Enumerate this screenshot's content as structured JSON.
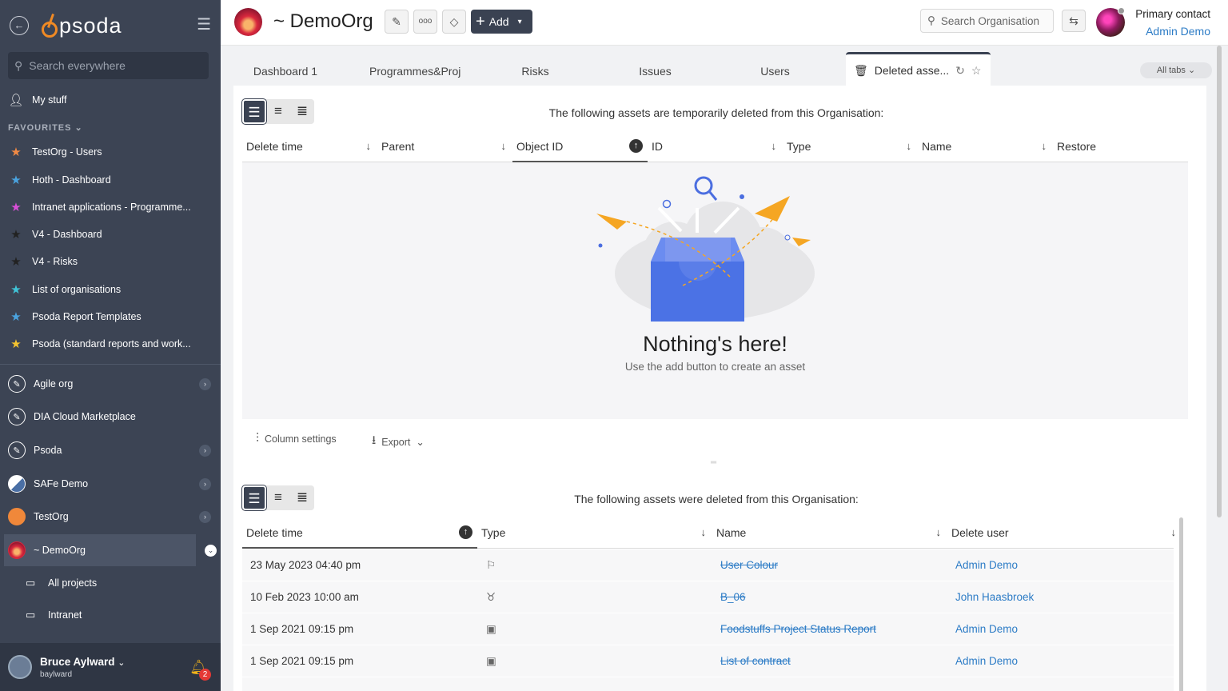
{
  "sidebar": {
    "logo": "psoda",
    "search_placeholder": "Search everywhere",
    "my_stuff": "My stuff",
    "favourites_heading": "FAVOURITES",
    "favourites": [
      {
        "label": "TestOrg - Users",
        "color": "#f08a45"
      },
      {
        "label": "Hoth - Dashboard",
        "color": "#4aa3df"
      },
      {
        "label": "Intranet applications - Programme...",
        "color": "#d94fd9"
      },
      {
        "label": "V4 - Dashboard",
        "color": "#2b2b2b"
      },
      {
        "label": "V4 - Risks",
        "color": "#2b2b2b"
      },
      {
        "label": "List of organisations",
        "color": "#40c4d8"
      },
      {
        "label": "Psoda Report Templates",
        "color": "#4aa3df"
      },
      {
        "label": "Psoda (standard reports and work...",
        "color": "#f4c430"
      }
    ],
    "orgs": [
      {
        "label": "Agile org"
      },
      {
        "label": "DIA Cloud Marketplace"
      },
      {
        "label": "Psoda"
      },
      {
        "label": "SAFe Demo"
      },
      {
        "label": "TestOrg"
      },
      {
        "label": "~ DemoOrg"
      }
    ],
    "sub_items": [
      "All projects",
      "Intranet"
    ],
    "user": {
      "name": "Bruce Aylward",
      "username": "baylward",
      "notifications": "2"
    }
  },
  "header": {
    "title": "~ DemoOrg",
    "add_label": "Add",
    "search_placeholder": "Search Organisation",
    "primary_contact_label": "Primary contact",
    "primary_contact_name": "Admin Demo"
  },
  "tabs": [
    "Dashboard 1",
    "Programmes&Proj",
    "Risks",
    "Issues",
    "Users",
    "Deleted asse..."
  ],
  "all_tabs_label": "All tabs",
  "temp_section": {
    "caption": "The following assets are temporarily deleted from this Organisation:",
    "columns": [
      "Delete time",
      "Parent",
      "Object ID",
      "ID",
      "Type",
      "Name",
      "Restore"
    ],
    "empty_title": "Nothing's here!",
    "empty_sub": "Use the add button to create an asset"
  },
  "toolbar": {
    "column_settings": "Column settings",
    "export": "Export"
  },
  "deleted_section": {
    "caption": "The following assets were deleted from this Organisation:",
    "columns": [
      "Delete time",
      "Type",
      "Name",
      "Delete user"
    ],
    "rows": [
      {
        "time": "23 May 2023 04:40 pm",
        "type_icon": "user-colour-icon",
        "name": "User Colour",
        "user": "Admin Demo"
      },
      {
        "time": "10 Feb 2023 10:00 am",
        "type_icon": "badge-icon",
        "name": "B_06",
        "user": "John Haasbroek"
      },
      {
        "time": "1 Sep 2021 09:15 pm",
        "type_icon": "report-icon",
        "name": "Foodstuffs Project Status Report",
        "user": "Admin Demo"
      },
      {
        "time": "1 Sep 2021 09:15 pm",
        "type_icon": "report-icon",
        "name": "List of contract",
        "user": "Admin Demo"
      }
    ]
  }
}
